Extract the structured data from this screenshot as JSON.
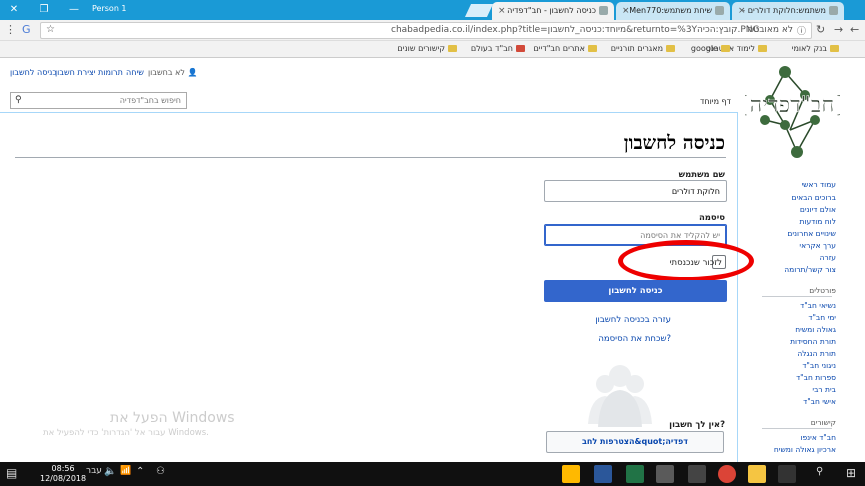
{
  "browser": {
    "tabs": [
      {
        "label": "משתמש:חלוקת דולרים -"
      },
      {
        "label": "שיחת משתמש:Men770 -"
      },
      {
        "label": "כניסה לחשבון - חב\"דפדיה"
      }
    ],
    "person": "Person 1",
    "address": {
      "security": "לא מאובטח",
      "url": "chabadpedia.co.il/index.php?title=מיוחד:כניסה_לחשבון&returnto=%3Yקובץ:הכיה.PNG"
    },
    "bookmarks": [
      "בנק לאומי",
      "לימוד אינטרנט",
      "google",
      "מאגרים תורניים",
      "אתרים חב\"דיים",
      "חב\"ד בעולם",
      "קישורים שונים"
    ]
  },
  "personal": {
    "not_logged_in": "לא בחשבון",
    "talk": "שיחה",
    "contributions": "תרומות",
    "create_account": "יצירת חשבון",
    "login": "כניסה לחשבון"
  },
  "search": {
    "placeholder": "חיפוש בחב\"דפדיה"
  },
  "special_tab": "דף מיוחד",
  "sidebar": {
    "nav": [
      "עמוד ראשי",
      "ברוכים הבאים",
      "אולם דיונים",
      "לוח מודעות",
      "שינויים אחרונים",
      "ערך אקראי",
      "עזרה",
      "צור קשר/תרומה"
    ],
    "portals_heading": "פורטלים",
    "portals": [
      "נשיאי חב\"ד",
      "ימי חב\"ד",
      "גאולה ומשיח",
      "תורת החסידות",
      "תורת הנגלה",
      "ניגוני חב\"ד",
      "ספרות חב\"ד",
      "בית רבי",
      "אישי חב\"ד"
    ],
    "links_heading": "קישורים",
    "links": [
      "חב\"ד אינפו",
      "ארכיון גאולה ומשיח"
    ]
  },
  "form": {
    "title": "כניסה לחשבון",
    "username_label": "שם משתמש",
    "username_value": "חלוקת דולרים",
    "password_label": "סיסמה",
    "password_placeholder": "יש להקליד את הסיסמה",
    "remember_label": "לזכור שנכנסתי",
    "login_button": "כניסה לחשבון",
    "help_link": "עזרה בכניסה לחשבון",
    "forgot_link": "שכחת את הסיסמה?",
    "no_account": "אין לך חשבון?",
    "join_button": "הצטרפות לחב&quot;דפדיה"
  },
  "watermark": {
    "line1": "הפעל את Windows",
    "line2": "עבור אל 'הגדרות' כדי להפעיל את Windows."
  },
  "taskbar": {
    "time": "08:56",
    "date": "12/08/2018",
    "lang": "עבר"
  }
}
